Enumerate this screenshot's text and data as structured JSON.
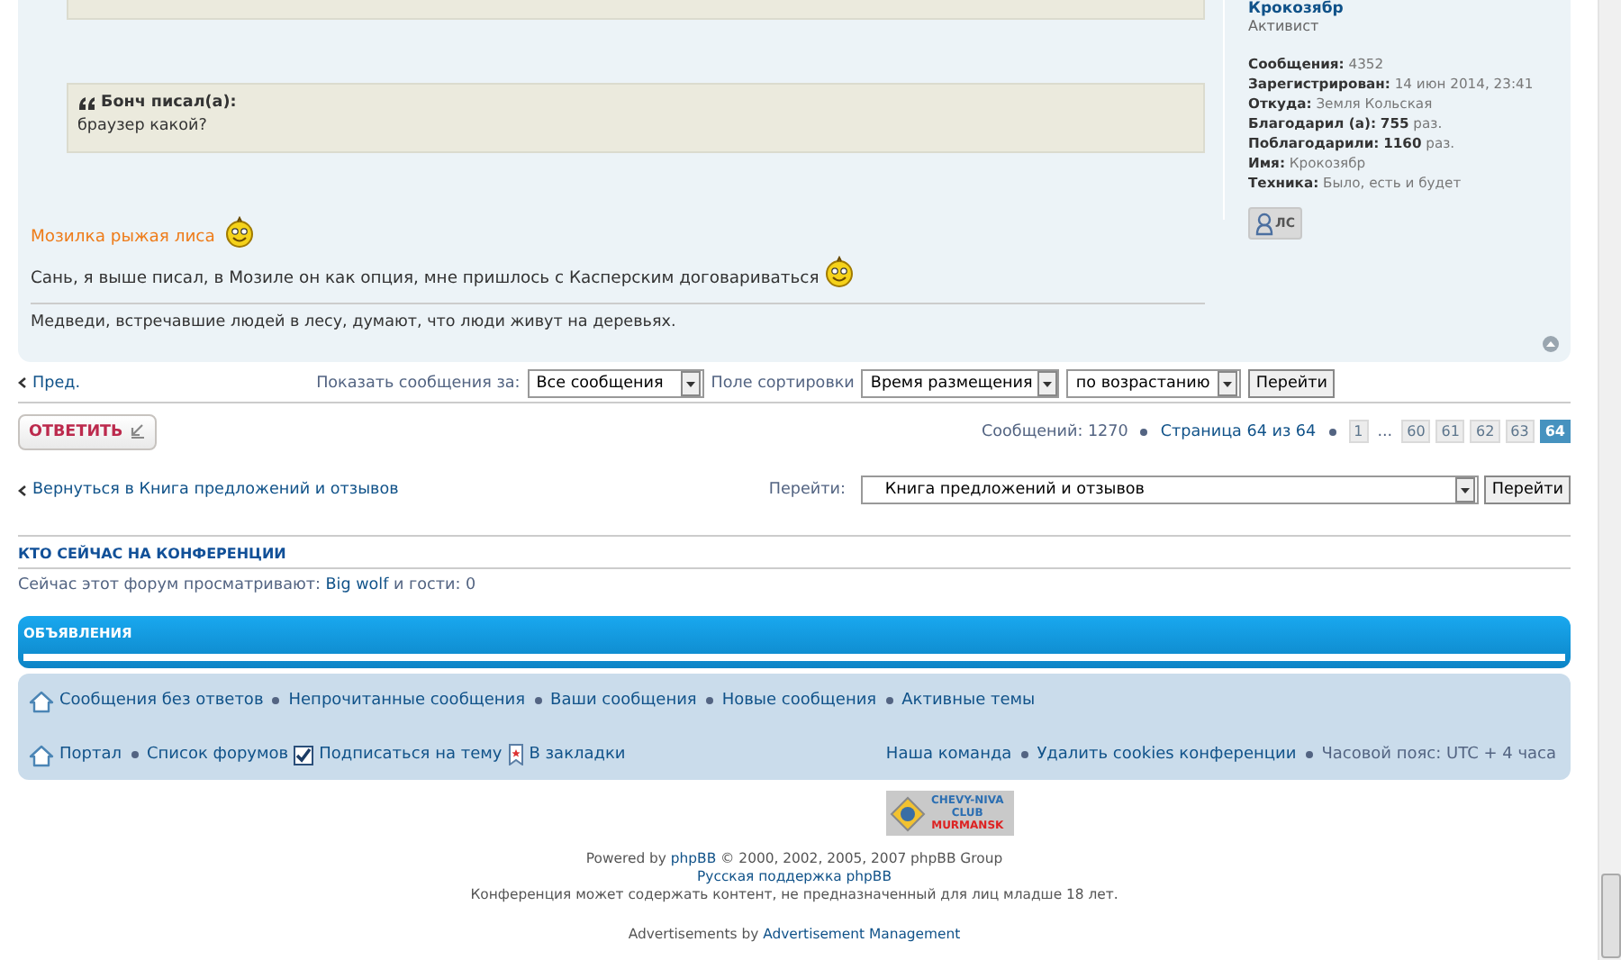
{
  "post": {
    "quote": {
      "author": "Бонч писал(а):",
      "text": "браузер какой?"
    },
    "message": {
      "title": "Мозилка рыжая лиса",
      "body": "Сань, я выше писал, в Мозиле он как опция, мне пришлось с Касперским договариваться"
    },
    "signature": "Медведи, встречавшие людей в лесу, думают, что люди живут на деревьях.",
    "profile": {
      "username": "Крокозябр",
      "rank": "Активист",
      "fields": [
        {
          "label": "Сообщения:",
          "value": "4352"
        },
        {
          "label": "Зарегистрирован:",
          "value": "14 июн 2014, 23:41"
        },
        {
          "label": "Откуда:",
          "value": "Земля Кольская"
        },
        {
          "label": "Благодарил (а):",
          "value": "**755** раз."
        },
        {
          "label": "Поблагодарили:",
          "value": "**1160** раз."
        },
        {
          "label": "Имя:",
          "value": "Крокозябр"
        },
        {
          "label": "Техника:",
          "value": "Было, есть и будет"
        }
      ],
      "pm_button": "ЛС"
    }
  },
  "display_options": {
    "prev": "Пред.",
    "show_label": "Показать сообщения за:",
    "show_value": "Все сообщения",
    "sort_label": "Поле сортировки",
    "sort_value": "Время размещения",
    "order_value": "по возрастанию",
    "go": "Перейти"
  },
  "reply_button": "ОТВЕТИТЬ",
  "pagination": {
    "count": "Сообщений: 1270",
    "page": "Страница 64 из 64",
    "pages": [
      {
        "label": "1",
        "kind": "page",
        "selected": false
      },
      {
        "label": "...",
        "kind": "ellipsis"
      },
      {
        "label": "60",
        "kind": "page",
        "selected": false
      },
      {
        "label": "61",
        "kind": "page",
        "selected": false
      },
      {
        "label": "62",
        "kind": "page",
        "selected": false
      },
      {
        "label": "63",
        "kind": "page",
        "selected": false
      },
      {
        "label": "64",
        "kind": "page",
        "selected": true
      }
    ]
  },
  "back_link": "Вернуться в Книга предложений и отзывов",
  "jump": {
    "label": "Перейти:",
    "value": "Книга предложений и отзывов",
    "button": "Перейти"
  },
  "online": {
    "heading": "КТО СЕЙЧАС НА КОНФЕРЕНЦИИ",
    "prefix": "Сейчас этот форум просматривают:",
    "user": "Big wolf",
    "suffix": "и гости: 0"
  },
  "announcements": {
    "heading": "ОБЪЯВЛЕНИЯ"
  },
  "navbar": {
    "row1": [
      {
        "label": "Сообщения без ответов",
        "kind": "home"
      },
      {
        "label": "Непрочитанные сообщения",
        "kind": "link"
      },
      {
        "label": "Ваши сообщения",
        "kind": "link"
      },
      {
        "label": "Новые сообщения",
        "kind": "link"
      },
      {
        "label": "Активные темы",
        "kind": "link"
      }
    ],
    "row2": [
      {
        "label": "Портал",
        "kind": "home"
      },
      {
        "label": "Список форумов",
        "kind": "link"
      },
      {
        "label": "Подписаться на тему",
        "kind": "checkbox"
      },
      {
        "label": "В закладки",
        "kind": "bookmark"
      }
    ],
    "right": [
      {
        "label": "Наша команда",
        "kind": "link"
      },
      {
        "label": "Удалить cookies конференции",
        "kind": "link"
      },
      {
        "label": "Часовой пояс: UTC + 4 часа",
        "kind": "text"
      }
    ]
  },
  "footer": {
    "logo": [
      "CHEVY-NIVA",
      "CLUB",
      "MURMANSK"
    ],
    "powered_prefix": "Powered by",
    "powered_link": "phpBB",
    "powered_suffix": "© 2000, 2002, 2005, 2007 phpBB Group",
    "support_link": "Русская поддержка phpBB",
    "disclaimer": "Конференция может содержать контент, не предназначенный для лиц младше 18 лет.",
    "ads_prefix": "Advertisements by",
    "ads_link": "Advertisement Management"
  }
}
